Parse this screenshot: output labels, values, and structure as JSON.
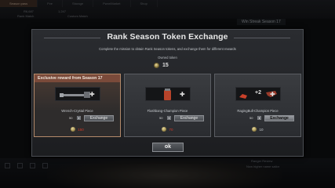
{
  "background": {
    "tabs": [
      "Season pass",
      "Pve",
      "Storage",
      "Pwnr/Market",
      "Shop"
    ],
    "info_left": [
      "Rank Match",
      "Custom Match"
    ],
    "info_values": [
      "R6,687",
      "1,247"
    ],
    "right_label": "Win Streak Season 17",
    "bottom_texts": [
      "...",
      "Ranger Review",
      "Now higher name sailor"
    ]
  },
  "modal": {
    "title": "Rank Season Token Exchange",
    "description": "Complete the mission to obtain Rank Season tokens, and exchange them for different rewards",
    "owned_label": "Owned token",
    "owned_count": "15",
    "cards": [
      {
        "banner": "Exclusive reward from Season 17",
        "item": "Wrench-Crystal Piece",
        "qty": "50",
        "exchange": "Exchange",
        "cost": "150",
        "affordable": false
      },
      {
        "banner": "",
        "item": "Flashbang-Champion Piece",
        "qty": "50",
        "exchange": "Exchange",
        "cost": "70",
        "affordable": false
      },
      {
        "banner": "",
        "item": "RagingBull-Champion Piece",
        "plus": "+2",
        "qty": "50",
        "exchange": "Exchange",
        "cost": "10",
        "affordable": true
      }
    ],
    "ok_label": "ok"
  },
  "colors": {
    "accent_banner": "#7a4a3a",
    "cost_insufficient": "#d43a2a",
    "text": "#cfd2d6"
  }
}
